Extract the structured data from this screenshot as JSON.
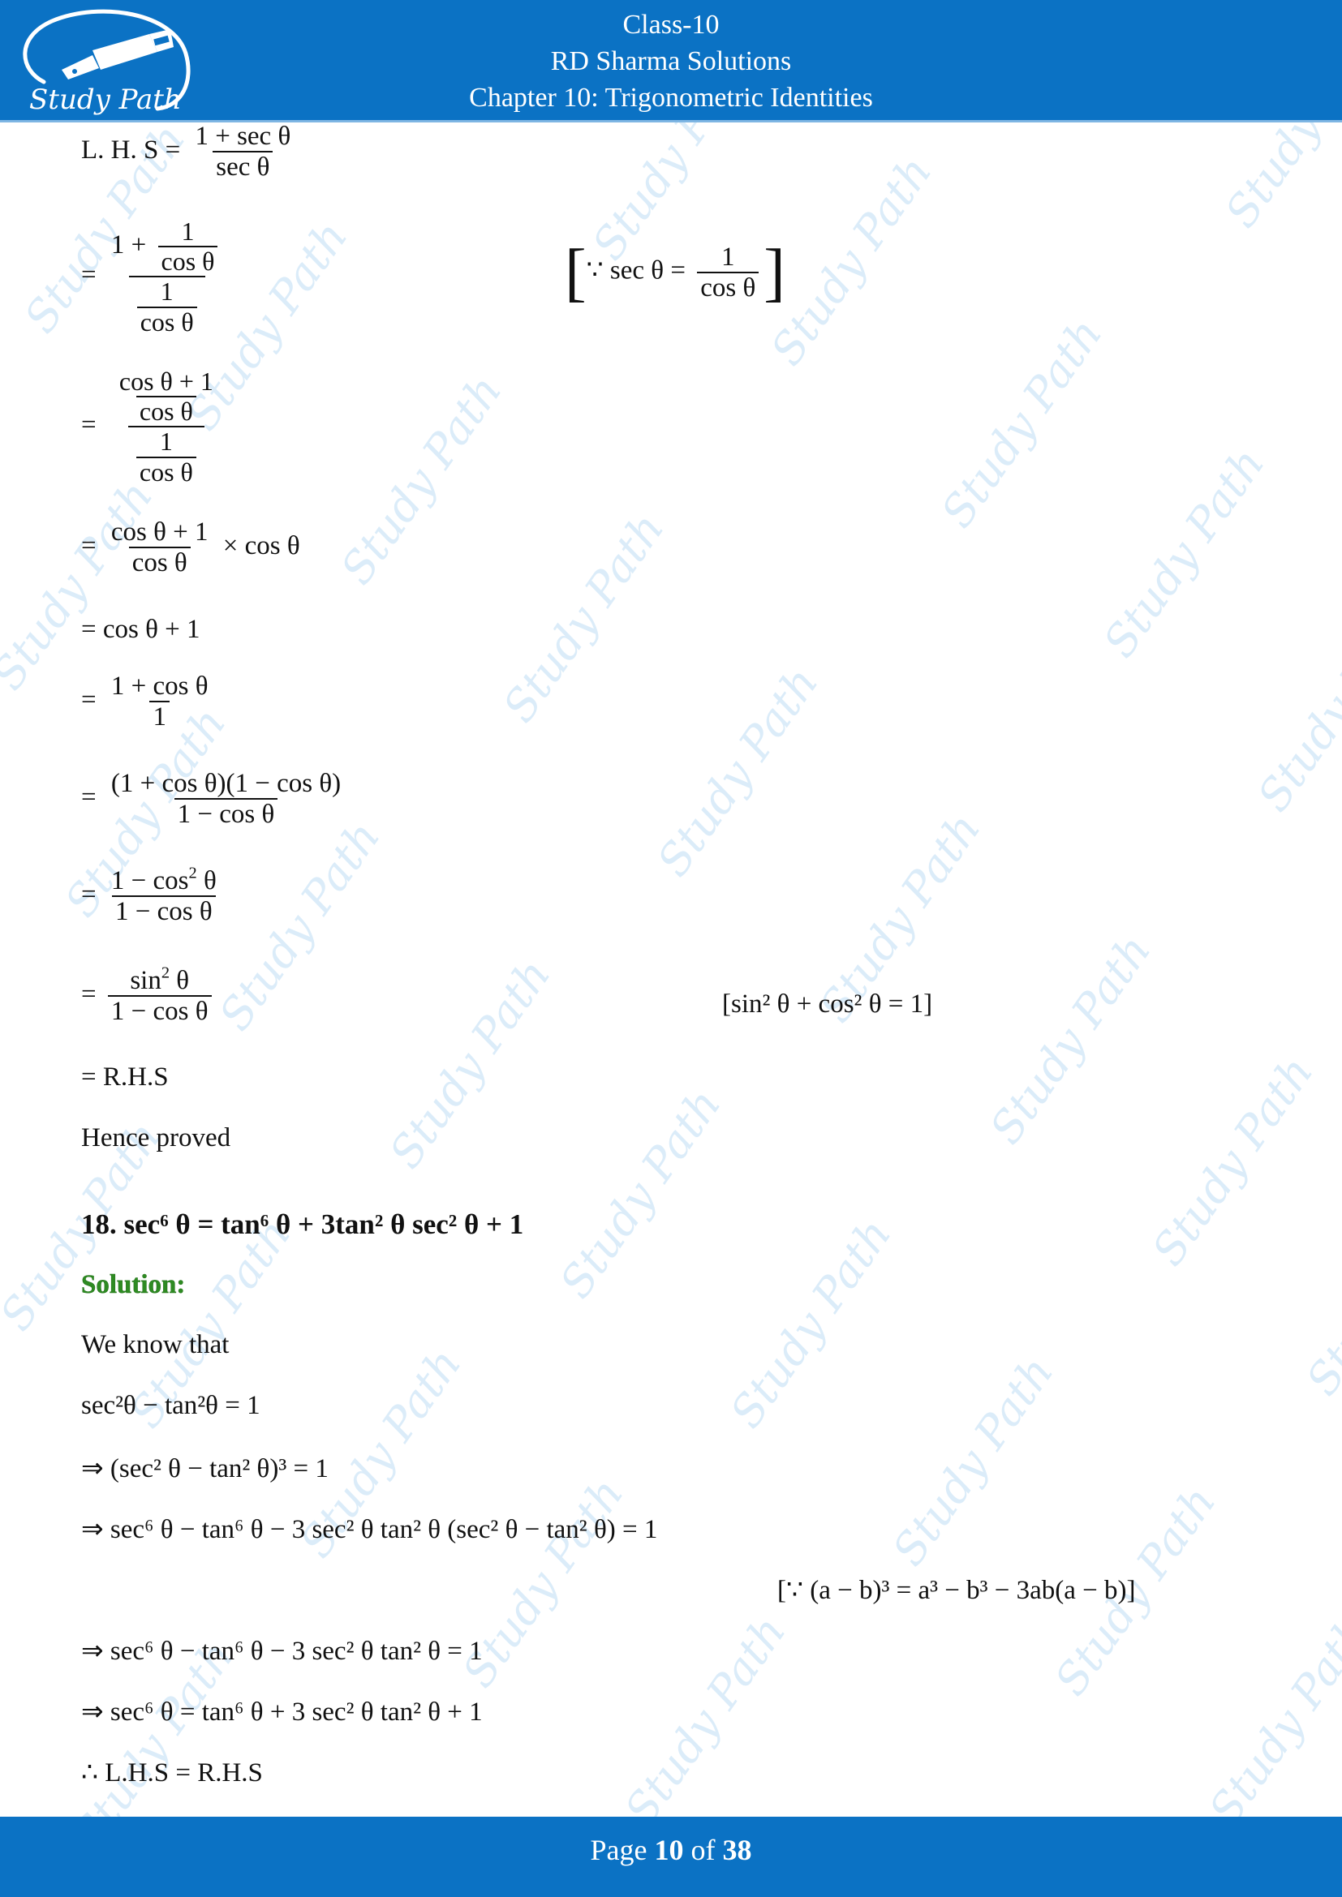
{
  "header": {
    "logo_text": "Study Path",
    "line1": "Class-10",
    "line2": "RD Sharma Solutions",
    "line3": "Chapter 10: Trigonometric Identities"
  },
  "watermark": "Study Path",
  "proof17": {
    "lhs_label": "L. H. S =",
    "lhs_num": "1 + sec θ",
    "lhs_den": "sec θ",
    "step1_outer_num_prefix": "1 +",
    "step1_inner_num": "1",
    "step1_inner_den": "cos θ",
    "step1_den_num": "1",
    "step1_den_den": "cos θ",
    "step1_note_prefix": "∵ sec θ =",
    "step1_note_num": "1",
    "step1_note_den": "cos θ",
    "step2_inner_num": "cos θ + 1",
    "step2_inner_den": "cos θ",
    "step2_den_num": "1",
    "step2_den_den": "cos θ",
    "step3_num": "cos θ + 1",
    "step3_den": "cos θ",
    "step3_suffix": "× cos θ",
    "step4": "= cos θ + 1",
    "step5_num": "1 + cos θ",
    "step5_den": "1",
    "step6_num": "(1 + cos θ)(1 − cos θ)",
    "step6_den": "1 − cos θ",
    "step7_num_a": "1 − cos",
    "step7_num_sup": "2",
    "step7_num_b": " θ",
    "step7_den": "1 − cos θ",
    "step8_num_a": "sin",
    "step8_num_sup": "2",
    "step8_num_b": " θ",
    "step8_den": "1 − cos θ",
    "step8_note": "[sin² θ + cos² θ = 1]",
    "step9": "= R.H.S",
    "conclusion": "Hence proved",
    "eq": "="
  },
  "question18": {
    "number": "18.",
    "statement": "sec⁶ θ = tan⁶ θ + 3tan² θ sec² θ + 1"
  },
  "solution18": {
    "label": "Solution:",
    "lines": [
      "We know that",
      "sec²θ − tan²θ = 1",
      "⇒ (sec² θ − tan² θ)³ = 1",
      "⇒ sec⁶ θ − tan⁶ θ − 3 sec² θ tan² θ (sec² θ − tan² θ) = 1",
      "⇒ sec⁶ θ − tan⁶ θ − 3 sec² θ tan² θ = 1",
      "⇒ sec⁶ θ = tan⁶ θ + 3 sec² θ tan² θ + 1",
      "∴ L.H.S = R.H.S"
    ],
    "note": "[∵ (a − b)³ = a³ − b³ − 3ab(a − b)]"
  },
  "footer": {
    "page_prefix": "Page",
    "page_current": "10",
    "page_of": "of",
    "page_total": "38"
  },
  "colors": {
    "header_bg": "#0b72c4",
    "solution_green": "#2e8b22",
    "watermark": "#cfe6f7"
  }
}
